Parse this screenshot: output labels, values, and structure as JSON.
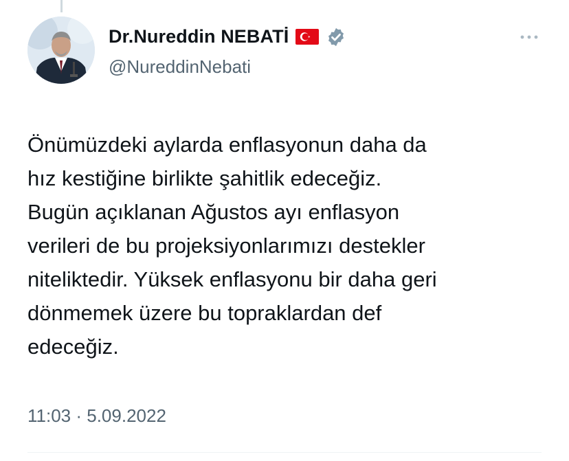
{
  "author": {
    "display_name": "Dr.Nureddin NEBATİ",
    "handle": "@NureddinNebati",
    "flag_icon": "turkey-flag-icon",
    "verified_icon": "verified-badge-icon",
    "avatar": "profile-photo"
  },
  "tweet": {
    "text": "Önümüzdeki aylarda enflasyonun daha da\nhız kestiğine birlikte şahitlik edeceğiz.\nBugün açıklanan Ağustos ayı enflasyon\nverileri de bu projeksiyonlarımızı destekler\nniteliktedir. Yüksek enflasyonu bir daha geri\ndönmemek üzere bu topraklardan def\nedeceğiz.",
    "timestamp": "11:03 · 5.09.2022"
  },
  "colors": {
    "text_primary": "#0f1419",
    "text_secondary": "#536471",
    "verified_badge": "#829aab",
    "flag_red": "#e30a17",
    "divider": "#eff3f4"
  },
  "icons": {
    "more": "more-options-icon"
  }
}
